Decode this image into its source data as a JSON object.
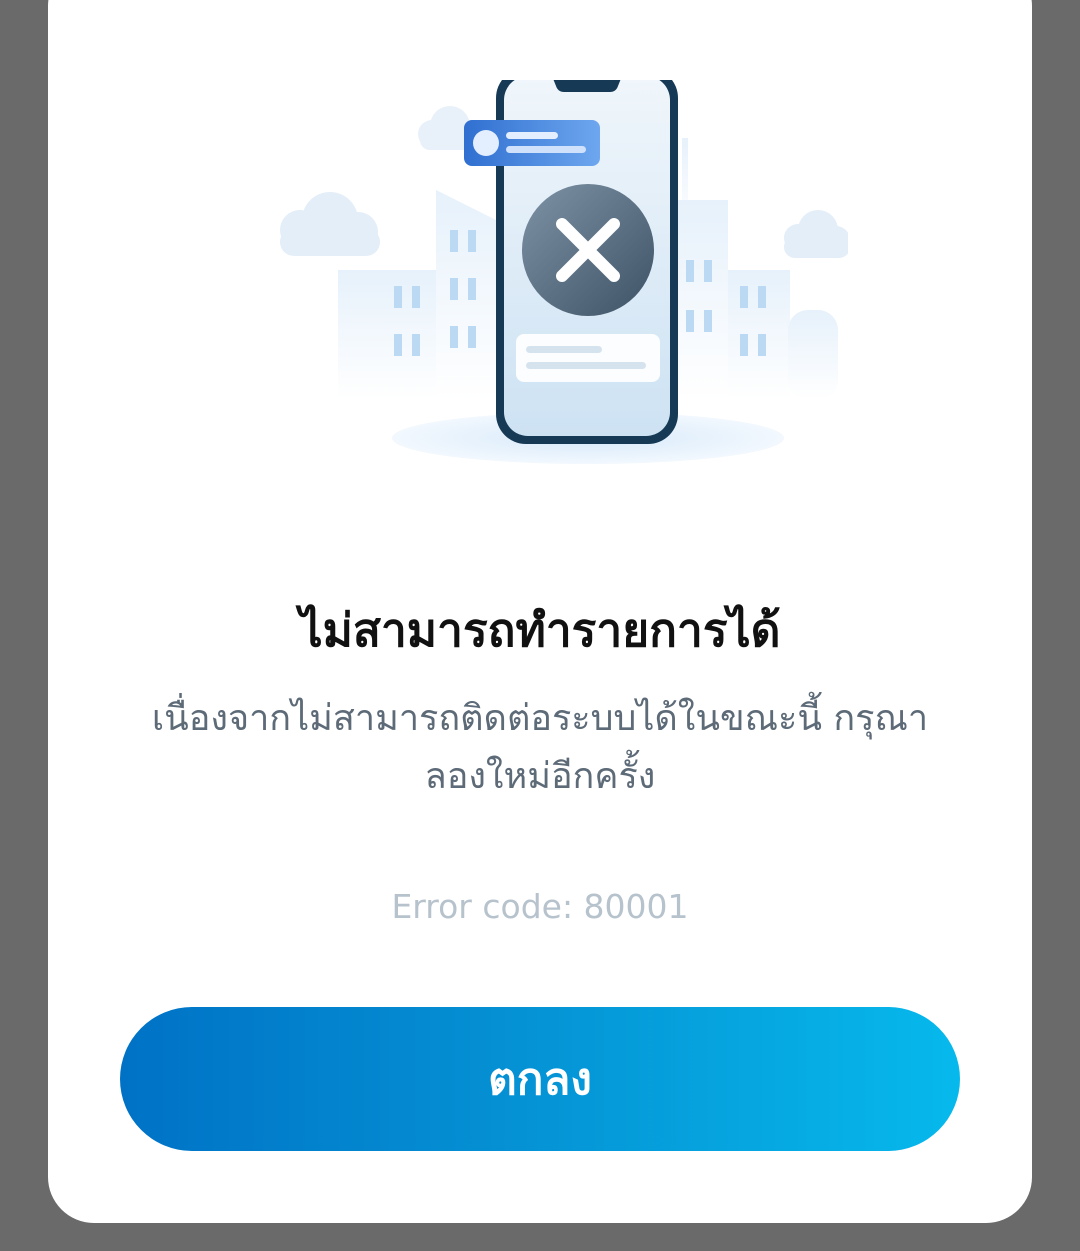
{
  "dialog": {
    "title": "ไม่สามารถทำรายการได้",
    "message": "เนื่องจากไม่สามารถติดต่อระบบได้ในขณะนี้ กรุณาลองใหม่อีกครั้ง",
    "error_code": "Error code: 80001",
    "ok_button_label": "ตกลง",
    "illustration_icon": "phone-error-x-icon"
  },
  "colors": {
    "accent_start": "#0072c6",
    "accent_end": "#06b9ec",
    "title": "#111111",
    "message": "#5d6a77",
    "error_code": "#b7c3cc",
    "backdrop": "#6a6a6a"
  }
}
